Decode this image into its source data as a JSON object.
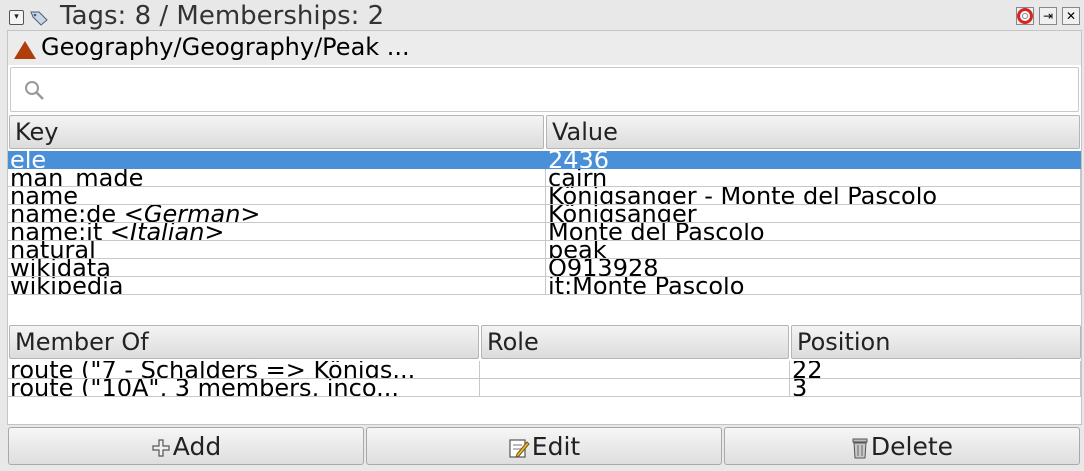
{
  "window": {
    "title": "Tags: 8 / Memberships: 2"
  },
  "object": {
    "title": "Geography/Geography/Peak ..."
  },
  "search": {
    "placeholder": "",
    "value": ""
  },
  "tags": {
    "headers": {
      "key": "Key",
      "value": "Value"
    },
    "rows": [
      {
        "key": "ele",
        "lang": "",
        "value": "2436",
        "selected": true
      },
      {
        "key": "man_made",
        "lang": "",
        "value": "cairn"
      },
      {
        "key": "name",
        "lang": "",
        "value": "Königsanger - Monte del Pascolo"
      },
      {
        "key": "name:de",
        "lang": "<German>",
        "value": "Königsanger"
      },
      {
        "key": "name:it",
        "lang": "<Italian>",
        "value": "Monte del Pascolo"
      },
      {
        "key": "natural",
        "lang": "",
        "value": "peak"
      },
      {
        "key": "wikidata",
        "lang": "",
        "value": "Q913928"
      },
      {
        "key": "wikipedia",
        "lang": "",
        "value": "it:Monte Pascolo"
      }
    ]
  },
  "memberships": {
    "headers": {
      "member_of": "Member Of",
      "role": "Role",
      "position": "Position"
    },
    "rows": [
      {
        "member_of": "route (\"7 - Schalders => Königs...",
        "role": "",
        "position": "22"
      },
      {
        "member_of": "route (\"10A\", 3 members, inco...",
        "role": "",
        "position": "3"
      }
    ]
  },
  "buttons": {
    "add": "Add",
    "edit": "Edit",
    "delete": "Delete"
  },
  "colors": {
    "selection": "#4a90d9",
    "object_icon": "#b03e0a"
  },
  "icons": [
    "toggle-icon",
    "tag-icon",
    "help-icon",
    "detach-icon",
    "close-icon",
    "peak-icon",
    "search-icon",
    "add-icon",
    "edit-icon",
    "delete-icon"
  ]
}
